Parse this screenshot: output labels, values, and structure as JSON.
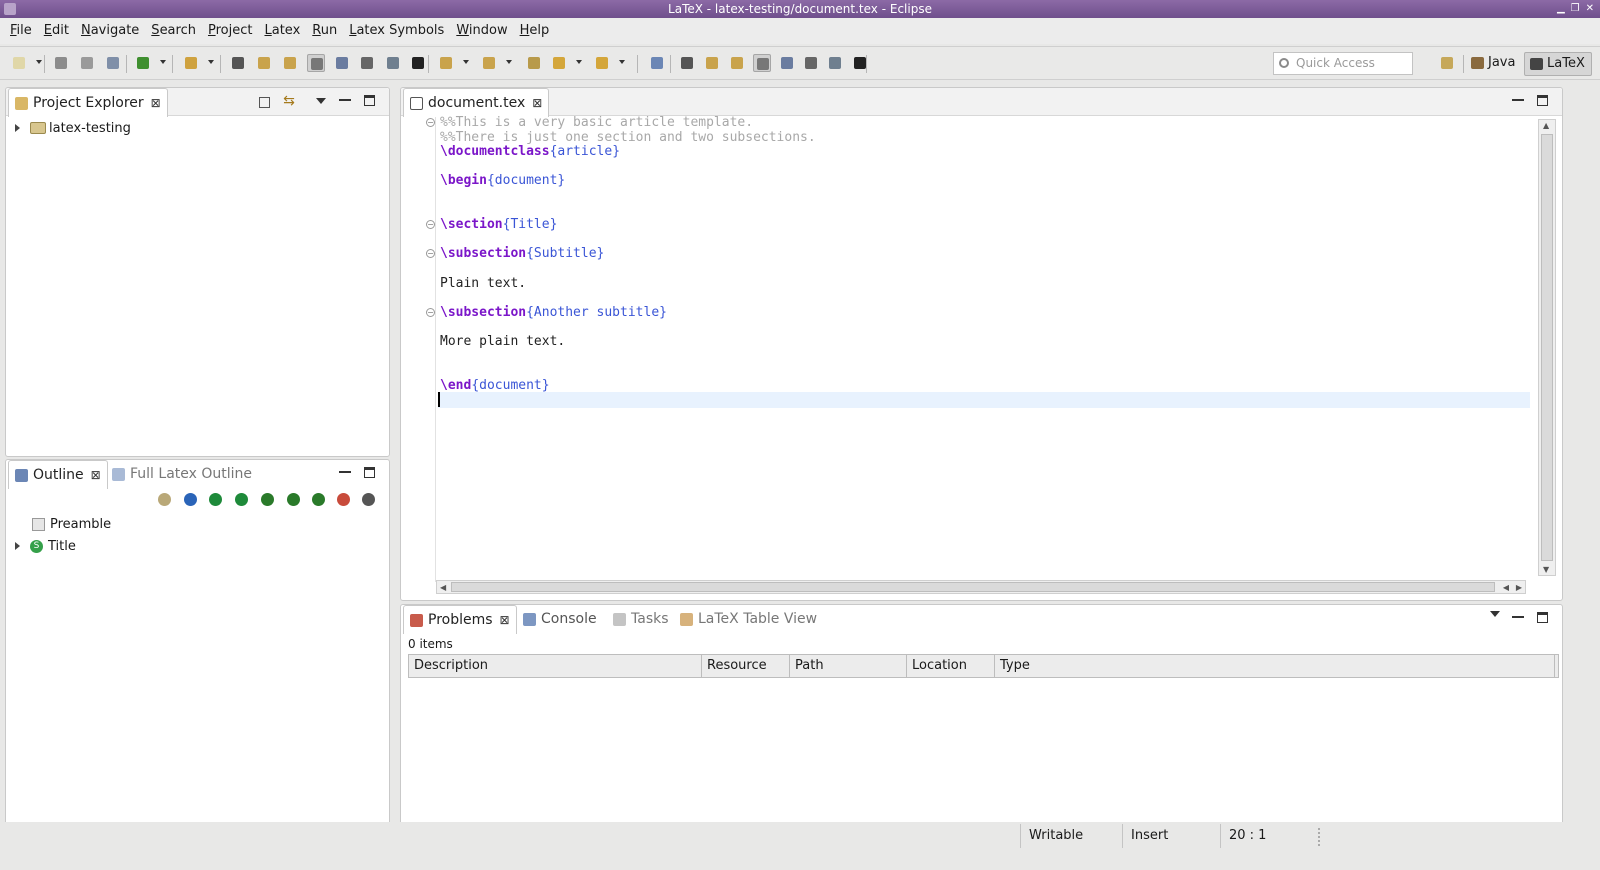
{
  "window": {
    "title": "LaTeX - latex-testing/document.tex - Eclipse"
  },
  "menubar": [
    {
      "label": "File"
    },
    {
      "label": "Edit"
    },
    {
      "label": "Navigate"
    },
    {
      "label": "Search"
    },
    {
      "label": "Project"
    },
    {
      "label": "Latex"
    },
    {
      "label": "Run"
    },
    {
      "label": "Latex Symbols"
    },
    {
      "label": "Window"
    },
    {
      "label": "Help"
    }
  ],
  "toolbar": {
    "quick_access_placeholder": "Quick Access",
    "perspectives": [
      {
        "label": "Java"
      },
      {
        "label": "LaTeX",
        "active": true
      }
    ]
  },
  "project_explorer": {
    "tab_label": "Project Explorer",
    "tree": [
      {
        "label": "latex-testing",
        "expandable": true
      }
    ]
  },
  "outline": {
    "tabs": [
      {
        "label": "Outline",
        "active": true
      },
      {
        "label": "Full Latex Outline"
      }
    ],
    "tree": [
      {
        "label": "Preamble",
        "icon": "preamble-icon"
      },
      {
        "label": "Title",
        "icon": "section-icon",
        "expandable": true
      }
    ]
  },
  "editor": {
    "tab_label": "document.tex",
    "lines": [
      {
        "parts": [
          {
            "t": "%%This is a very basic article template.",
            "c": "cmt"
          }
        ],
        "fold": true
      },
      {
        "parts": [
          {
            "t": "%%There is just one section and two subsections.",
            "c": "cmt"
          }
        ]
      },
      {
        "parts": [
          {
            "t": "\\documentclass",
            "c": "kw"
          },
          {
            "t": "{article}",
            "c": "arg"
          }
        ]
      },
      {
        "parts": []
      },
      {
        "parts": [
          {
            "t": "\\begin",
            "c": "kw"
          },
          {
            "t": "{document}",
            "c": "arg"
          }
        ]
      },
      {
        "parts": []
      },
      {
        "parts": []
      },
      {
        "parts": [
          {
            "t": "\\section",
            "c": "kw"
          },
          {
            "t": "{Title}",
            "c": "arg"
          }
        ],
        "fold": true
      },
      {
        "parts": []
      },
      {
        "parts": [
          {
            "t": "\\subsection",
            "c": "kw"
          },
          {
            "t": "{Subtitle}",
            "c": "arg"
          }
        ],
        "fold": true
      },
      {
        "parts": []
      },
      {
        "parts": [
          {
            "t": "Plain text.",
            "c": "plain"
          }
        ]
      },
      {
        "parts": []
      },
      {
        "parts": [
          {
            "t": "\\subsection",
            "c": "kw"
          },
          {
            "t": "{Another subtitle}",
            "c": "arg"
          }
        ],
        "fold": true
      },
      {
        "parts": []
      },
      {
        "parts": [
          {
            "t": "More plain text.",
            "c": "plain"
          }
        ]
      },
      {
        "parts": []
      },
      {
        "parts": []
      },
      {
        "parts": [
          {
            "t": "\\end",
            "c": "kw"
          },
          {
            "t": "{document}",
            "c": "arg"
          }
        ]
      },
      {
        "parts": []
      }
    ]
  },
  "bottom": {
    "tabs": [
      {
        "label": "Problems",
        "active": true,
        "closable": true
      },
      {
        "label": "Console"
      },
      {
        "label": "Tasks"
      },
      {
        "label": "LaTeX Table View"
      }
    ],
    "items_count": "0 items",
    "columns": [
      "Description",
      "Resource",
      "Path",
      "Location",
      "Type"
    ]
  },
  "statusbar": {
    "writable": "Writable",
    "insert_mode": "Insert",
    "position": "20 : 1"
  }
}
